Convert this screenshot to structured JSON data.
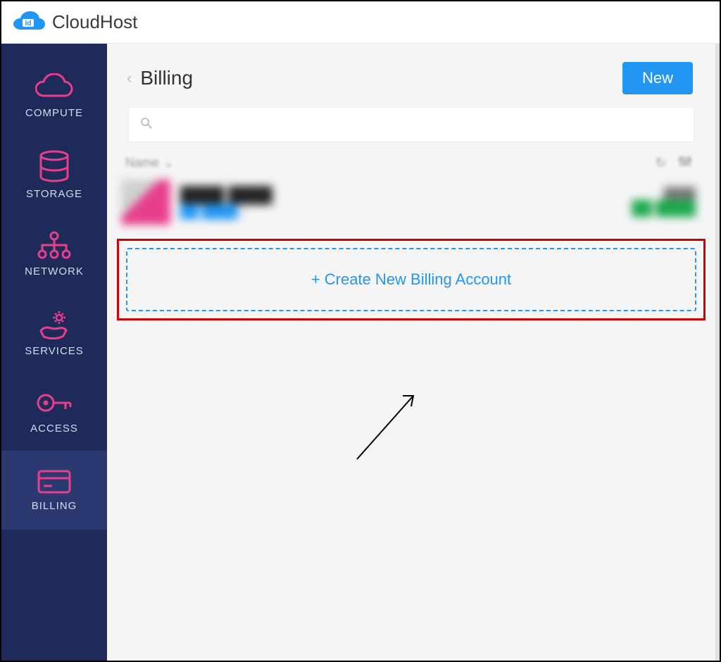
{
  "brand": {
    "name": "CloudHost",
    "badge": "Id"
  },
  "sidebar": {
    "items": [
      {
        "label": "COMPUTE"
      },
      {
        "label": "STORAGE"
      },
      {
        "label": "NETWORK"
      },
      {
        "label": "SERVICES"
      },
      {
        "label": "ACCESS"
      },
      {
        "label": "BILLING"
      }
    ]
  },
  "header": {
    "title": "Billing",
    "new_button": "New"
  },
  "table": {
    "sort_column": "Name"
  },
  "create_button": {
    "label": "+ Create New Billing Account"
  }
}
